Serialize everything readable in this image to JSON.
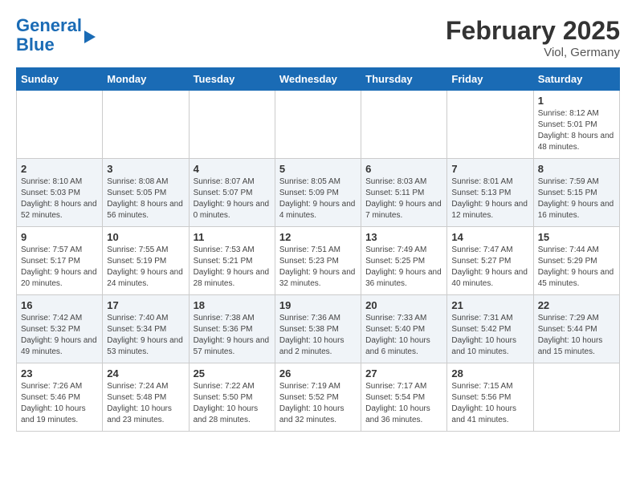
{
  "header": {
    "logo_line1": "General",
    "logo_line2": "Blue",
    "month": "February 2025",
    "location": "Viol, Germany"
  },
  "weekdays": [
    "Sunday",
    "Monday",
    "Tuesday",
    "Wednesday",
    "Thursday",
    "Friday",
    "Saturday"
  ],
  "weeks": [
    [
      {
        "day": "",
        "info": ""
      },
      {
        "day": "",
        "info": ""
      },
      {
        "day": "",
        "info": ""
      },
      {
        "day": "",
        "info": ""
      },
      {
        "day": "",
        "info": ""
      },
      {
        "day": "",
        "info": ""
      },
      {
        "day": "1",
        "info": "Sunrise: 8:12 AM\nSunset: 5:01 PM\nDaylight: 8 hours and 48 minutes."
      }
    ],
    [
      {
        "day": "2",
        "info": "Sunrise: 8:10 AM\nSunset: 5:03 PM\nDaylight: 8 hours and 52 minutes."
      },
      {
        "day": "3",
        "info": "Sunrise: 8:08 AM\nSunset: 5:05 PM\nDaylight: 8 hours and 56 minutes."
      },
      {
        "day": "4",
        "info": "Sunrise: 8:07 AM\nSunset: 5:07 PM\nDaylight: 9 hours and 0 minutes."
      },
      {
        "day": "5",
        "info": "Sunrise: 8:05 AM\nSunset: 5:09 PM\nDaylight: 9 hours and 4 minutes."
      },
      {
        "day": "6",
        "info": "Sunrise: 8:03 AM\nSunset: 5:11 PM\nDaylight: 9 hours and 7 minutes."
      },
      {
        "day": "7",
        "info": "Sunrise: 8:01 AM\nSunset: 5:13 PM\nDaylight: 9 hours and 12 minutes."
      },
      {
        "day": "8",
        "info": "Sunrise: 7:59 AM\nSunset: 5:15 PM\nDaylight: 9 hours and 16 minutes."
      }
    ],
    [
      {
        "day": "9",
        "info": "Sunrise: 7:57 AM\nSunset: 5:17 PM\nDaylight: 9 hours and 20 minutes."
      },
      {
        "day": "10",
        "info": "Sunrise: 7:55 AM\nSunset: 5:19 PM\nDaylight: 9 hours and 24 minutes."
      },
      {
        "day": "11",
        "info": "Sunrise: 7:53 AM\nSunset: 5:21 PM\nDaylight: 9 hours and 28 minutes."
      },
      {
        "day": "12",
        "info": "Sunrise: 7:51 AM\nSunset: 5:23 PM\nDaylight: 9 hours and 32 minutes."
      },
      {
        "day": "13",
        "info": "Sunrise: 7:49 AM\nSunset: 5:25 PM\nDaylight: 9 hours and 36 minutes."
      },
      {
        "day": "14",
        "info": "Sunrise: 7:47 AM\nSunset: 5:27 PM\nDaylight: 9 hours and 40 minutes."
      },
      {
        "day": "15",
        "info": "Sunrise: 7:44 AM\nSunset: 5:29 PM\nDaylight: 9 hours and 45 minutes."
      }
    ],
    [
      {
        "day": "16",
        "info": "Sunrise: 7:42 AM\nSunset: 5:32 PM\nDaylight: 9 hours and 49 minutes."
      },
      {
        "day": "17",
        "info": "Sunrise: 7:40 AM\nSunset: 5:34 PM\nDaylight: 9 hours and 53 minutes."
      },
      {
        "day": "18",
        "info": "Sunrise: 7:38 AM\nSunset: 5:36 PM\nDaylight: 9 hours and 57 minutes."
      },
      {
        "day": "19",
        "info": "Sunrise: 7:36 AM\nSunset: 5:38 PM\nDaylight: 10 hours and 2 minutes."
      },
      {
        "day": "20",
        "info": "Sunrise: 7:33 AM\nSunset: 5:40 PM\nDaylight: 10 hours and 6 minutes."
      },
      {
        "day": "21",
        "info": "Sunrise: 7:31 AM\nSunset: 5:42 PM\nDaylight: 10 hours and 10 minutes."
      },
      {
        "day": "22",
        "info": "Sunrise: 7:29 AM\nSunset: 5:44 PM\nDaylight: 10 hours and 15 minutes."
      }
    ],
    [
      {
        "day": "23",
        "info": "Sunrise: 7:26 AM\nSunset: 5:46 PM\nDaylight: 10 hours and 19 minutes."
      },
      {
        "day": "24",
        "info": "Sunrise: 7:24 AM\nSunset: 5:48 PM\nDaylight: 10 hours and 23 minutes."
      },
      {
        "day": "25",
        "info": "Sunrise: 7:22 AM\nSunset: 5:50 PM\nDaylight: 10 hours and 28 minutes."
      },
      {
        "day": "26",
        "info": "Sunrise: 7:19 AM\nSunset: 5:52 PM\nDaylight: 10 hours and 32 minutes."
      },
      {
        "day": "27",
        "info": "Sunrise: 7:17 AM\nSunset: 5:54 PM\nDaylight: 10 hours and 36 minutes."
      },
      {
        "day": "28",
        "info": "Sunrise: 7:15 AM\nSunset: 5:56 PM\nDaylight: 10 hours and 41 minutes."
      },
      {
        "day": "",
        "info": ""
      }
    ]
  ]
}
